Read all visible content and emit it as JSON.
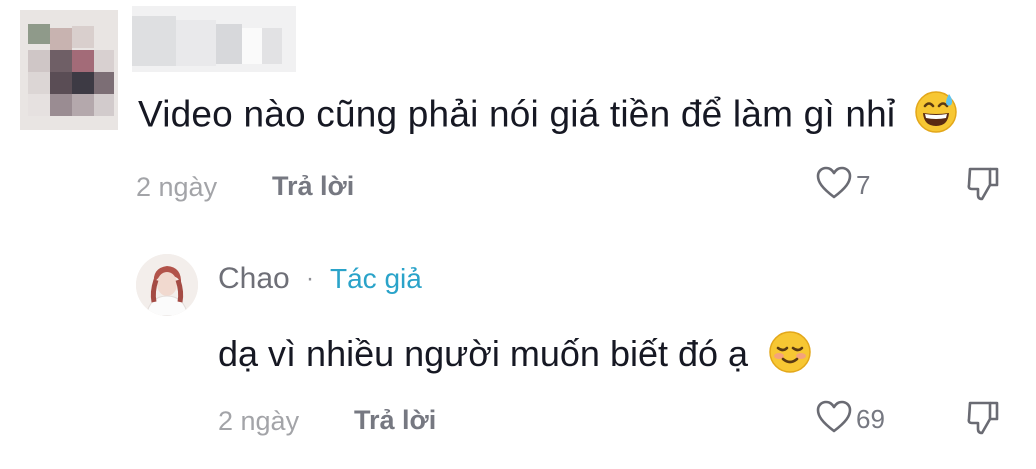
{
  "comment": {
    "text": "Video nào cũng phải nói giá tiền để làm gì nhỉ",
    "emoji": "grinning-face-with-sweat",
    "time": "2 ngày",
    "reply_label": "Trả lời",
    "likes": "7"
  },
  "reply": {
    "author": "Chao",
    "separator": "·",
    "badge": "Tác giả",
    "text": "dạ vì nhiều người muốn biết đó ạ",
    "emoji": "smiling-face",
    "time": "2 ngày",
    "reply_label": "Trả lời",
    "likes": "69"
  },
  "colors": {
    "text": "#161823",
    "muted": "#a3a4a8",
    "reply_link": "#767881",
    "author_badge": "#2aa3c9"
  }
}
